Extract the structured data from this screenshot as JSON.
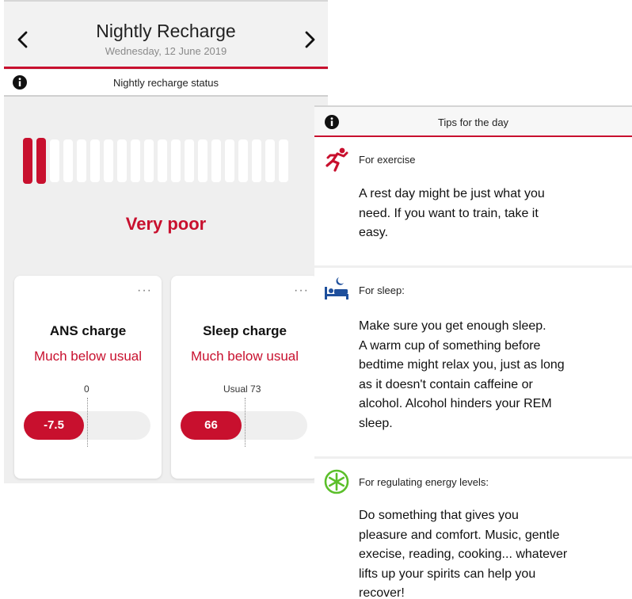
{
  "header": {
    "title": "Nightly Recharge",
    "date": "Wednesday, 12 June 2019",
    "prev_icon": "chevron-left-icon",
    "next_icon": "chevron-right-icon"
  },
  "status_bar": {
    "icon": "info-icon",
    "label": "Nightly recharge status"
  },
  "gauge": {
    "total_segments": 20,
    "filled_segments": 2,
    "active_color": "#c8102e",
    "inactive_color": "#ffffff"
  },
  "status_value": "Very poor",
  "cards": {
    "ans": {
      "menu": "···",
      "title": "ANS charge",
      "subtitle": "Much below usual",
      "reference_label": "0",
      "value_label": "-7.5"
    },
    "sleep": {
      "menu": "···",
      "title": "Sleep charge",
      "subtitle": "Much below usual",
      "reference_label": "Usual 73",
      "value_label": "66"
    }
  },
  "tips": {
    "icon": "info-icon",
    "title": "Tips for the day",
    "items": [
      {
        "icon": "running-person-icon",
        "label": "For exercise",
        "lines": [
          "A rest day might be just what you",
          "need. If you want to train, take it",
          "easy."
        ]
      },
      {
        "icon": "sleeping-bed-icon",
        "label": "For sleep:",
        "lines": [
          "Make sure you get enough sleep.",
          "A warm cup of something before",
          "bedtime might relax you, just as long",
          "as it doesn't contain caffeine or",
          "alcohol. Alcohol hinders your REM",
          "sleep."
        ]
      },
      {
        "icon": "energy-asterisk-icon",
        "label": "For regulating energy levels:",
        "lines": [
          "Do something that gives you",
          "pleasure and comfort. Music, gentle",
          "execise, reading, cooking... whatever",
          "lifts up your spirits can help you",
          "recover!"
        ]
      }
    ]
  },
  "colors": {
    "accent": "#c8102e",
    "energy_green": "#5bbf2a"
  }
}
